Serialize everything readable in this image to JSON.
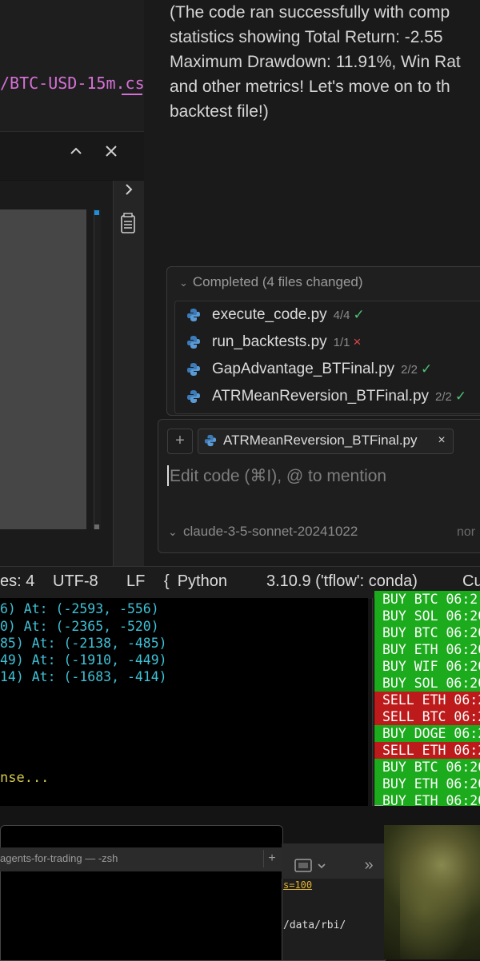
{
  "editor": {
    "path_fragment": "/BTC-USD-15m.cs"
  },
  "panel": {
    "up_glyph": "^",
    "close_glyph": "×",
    "chevron_glyph": "›"
  },
  "chat": {
    "message_lines": [
      "(The code ran successfully with comp",
      "statistics showing Total Return: -2.55",
      "Maximum Drawdown: 11.91%, Win Rat",
      "and other metrics! Let's move on to th",
      "backtest file!)"
    ],
    "completed_title": "Completed (4 files changed)",
    "files": [
      {
        "name": "execute_code.py",
        "count": "4/4",
        "status": "✓"
      },
      {
        "name": "run_backtests.py",
        "count": "1/1",
        "status": "×"
      },
      {
        "name": "GapAdvantage_BTFinal.py",
        "count": "2/2",
        "status": "✓"
      },
      {
        "name": "ATRMeanReversion_BTFinal.py",
        "count": "2/2",
        "status": "✓"
      }
    ],
    "add_glyph": "+",
    "context_chip": "ATRMeanReversion_BTFinal.py",
    "chip_close": "×",
    "input_placeholder": "Edit code (⌘I), @ to mention",
    "model": "claude-3-5-sonnet-20241022",
    "mode": "nor"
  },
  "statusbar": {
    "spaces": "es: 4",
    "encoding": "UTF-8",
    "eol": "LF",
    "lang_glyph": "{",
    "language": "Python",
    "interpreter": "3.10.9 ('tflow': conda)",
    "cursor": "Cu"
  },
  "terminal_left": {
    "lines": [
      "6) At: (-2593, -556)",
      "0) At: (-2365, -520)",
      "85) At: (-2138, -485)",
      "49) At: (-1910, -449)",
      "14) At: (-1683, -414)"
    ],
    "status_line": "nse..."
  },
  "terminal_right": {
    "trades": [
      {
        "text": "BUY BTC 06:2",
        "side": "buy"
      },
      {
        "text": "BUY SOL 06:20",
        "side": "buy"
      },
      {
        "text": "BUY BTC 06:20",
        "side": "buy"
      },
      {
        "text": "BUY ETH 06:20",
        "side": "buy"
      },
      {
        "text": "BUY WIF 06:20",
        "side": "buy"
      },
      {
        "text": "BUY SOL 06:20",
        "side": "buy"
      },
      {
        "text": "SELL ETH 06:2",
        "side": "sell"
      },
      {
        "text": "SELL BTC 06:2",
        "side": "sell"
      },
      {
        "text": "BUY DOGE 06:2",
        "side": "buy"
      },
      {
        "text": "SELL ETH 06:2",
        "side": "sell"
      },
      {
        "text": "BUY BTC 06:20",
        "side": "buy"
      },
      {
        "text": "BUY ETH 06:20",
        "side": "buy"
      },
      {
        "text": "BUY ETH 06:20",
        "side": "buy"
      }
    ],
    "colors": {
      "buy": "#1cab1c",
      "sell": "#bd1b1b"
    }
  },
  "zsh": {
    "title": "agents-for-trading — -zsh",
    "plus": "+"
  },
  "finder": {
    "more": "»",
    "link_text": "s=100",
    "path_text": "/data/rbi/"
  },
  "icons": [
    "python-file-icon",
    "check-icon",
    "close-icon",
    "chevron-up-icon",
    "chevron-right-icon",
    "document-icon",
    "plus-icon",
    "chevron-down-icon",
    "braces-icon"
  ]
}
